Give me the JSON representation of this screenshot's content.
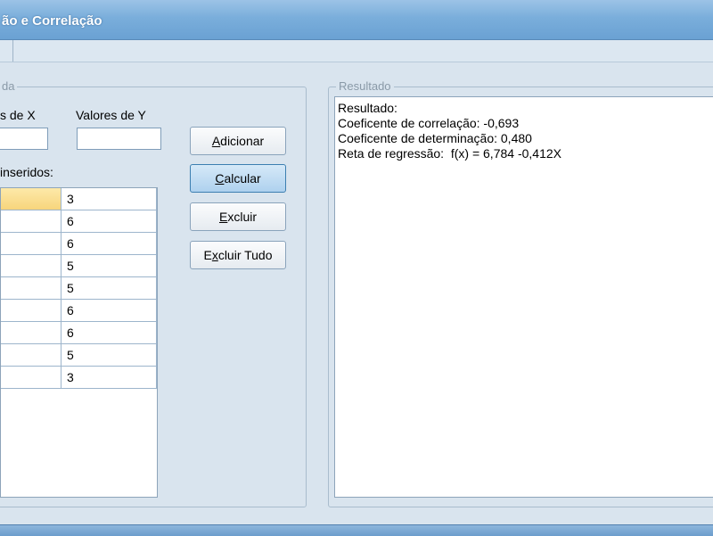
{
  "window": {
    "title": "ão e Correlação"
  },
  "input_group": {
    "legend": "da",
    "x_label": "s de X",
    "y_label": "Valores de Y",
    "x_value": "",
    "y_value": "",
    "inserted_label": "inseridos:"
  },
  "buttons": {
    "add": {
      "pre": "",
      "accel": "A",
      "post": "dicionar"
    },
    "calc": {
      "pre": "",
      "accel": "C",
      "post": "alcular"
    },
    "del": {
      "pre": "",
      "accel": "E",
      "post": "xcluir"
    },
    "del_all": {
      "pre": "E",
      "accel": "x",
      "post": "cluir Tudo"
    }
  },
  "table": {
    "rows": [
      {
        "x": "",
        "y": "3"
      },
      {
        "x": "",
        "y": "6"
      },
      {
        "x": "",
        "y": "6"
      },
      {
        "x": "",
        "y": "5"
      },
      {
        "x": "",
        "y": "5"
      },
      {
        "x": "",
        "y": "6"
      },
      {
        "x": "",
        "y": "6"
      },
      {
        "x": "",
        "y": "5"
      },
      {
        "x": "",
        "y": "3"
      }
    ]
  },
  "results": {
    "legend": "Resultado",
    "lines": [
      "Resultado:",
      "Coeficente de correlação: -0,693",
      "Coeficente de determinação: 0,480",
      "Reta de regressão:  f(x) = 6,784 -0,412X"
    ]
  }
}
